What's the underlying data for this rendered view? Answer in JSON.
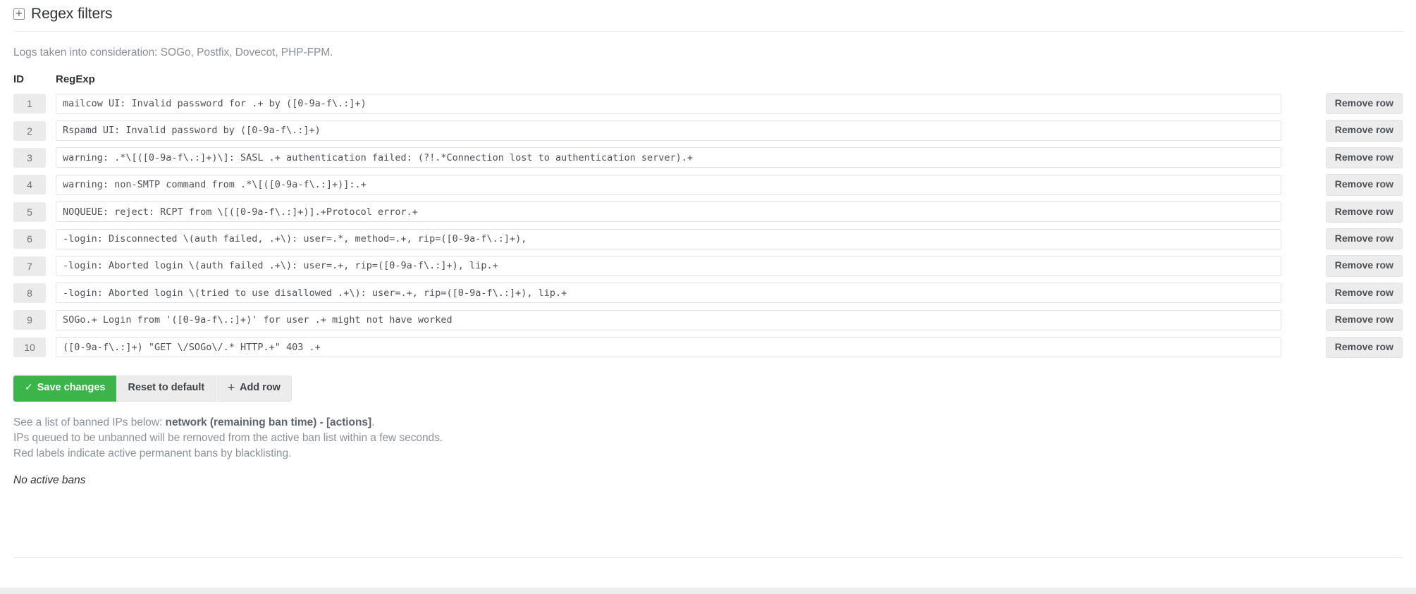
{
  "panel": {
    "expand_icon": "plus-box-icon",
    "expand_symbol": "+",
    "title": "Regex filters"
  },
  "intro_note": "Logs taken into consideration: SOGo, Postfix, Dovecot, PHP-FPM.",
  "table": {
    "headers": {
      "id": "ID",
      "regexp": "RegExp",
      "actions": ""
    },
    "remove_label": "Remove row",
    "rows": [
      {
        "id": "1",
        "regex": "mailcow UI: Invalid password for .+ by ([0-9a-f\\.:]+)"
      },
      {
        "id": "2",
        "regex": "Rspamd UI: Invalid password by ([0-9a-f\\.:]+)"
      },
      {
        "id": "3",
        "regex": "warning: .*\\[([0-9a-f\\.:]+)\\]: SASL .+ authentication failed: (?!.*Connection lost to authentication server).+"
      },
      {
        "id": "4",
        "regex": "warning: non-SMTP command from .*\\[([0-9a-f\\.:]+)]:.+"
      },
      {
        "id": "5",
        "regex": "NOQUEUE: reject: RCPT from \\[([0-9a-f\\.:]+)].+Protocol error.+"
      },
      {
        "id": "6",
        "regex": "-login: Disconnected \\(auth failed, .+\\): user=.*, method=.+, rip=([0-9a-f\\.:]+),"
      },
      {
        "id": "7",
        "regex": "-login: Aborted login \\(auth failed .+\\): user=.+, rip=([0-9a-f\\.:]+), lip.+"
      },
      {
        "id": "8",
        "regex": "-login: Aborted login \\(tried to use disallowed .+\\): user=.+, rip=([0-9a-f\\.:]+), lip.+"
      },
      {
        "id": "9",
        "regex": "SOGo.+ Login from '([0-9a-f\\.:]+)' for user .+ might not have worked"
      },
      {
        "id": "10",
        "regex": "([0-9a-f\\.:]+) \"GET \\/SOGo\\/.* HTTP.+\" 403 .+"
      }
    ]
  },
  "toolbar": {
    "save_check": "✓",
    "save_label": "Save changes",
    "reset_label": "Reset to default",
    "add_plus": "+",
    "add_label": "Add row"
  },
  "info": {
    "line1_prefix": "See a list of banned IPs below: ",
    "line1_bold": "network (remaining ban time) - [actions]",
    "line1_suffix": ".",
    "line2": "IPs queued to be unbanned will be removed from the active ban list within a few seconds.",
    "line3": "Red labels indicate active permanent bans by blacklisting.",
    "no_bans": "No active bans"
  },
  "colors": {
    "accent_green": "#3bb54a",
    "muted_text": "#8a9199",
    "id_cell_bg": "#ebebeb"
  }
}
